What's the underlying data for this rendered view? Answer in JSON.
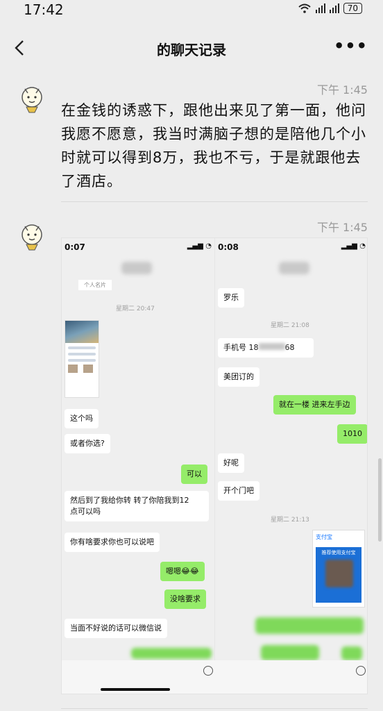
{
  "status": {
    "time": "17:42",
    "battery": "70"
  },
  "nav": {
    "title": "的聊天记录",
    "more": "•••"
  },
  "messages": [
    {
      "time": "下午 1:45",
      "text": "在金钱的诱惑下，跟他出来见了第一面，他问我愿不愿意，我当时满脑子想的是陪他几个小时就可以得到8万，我也不亏，于是就跟他去了酒店。"
    },
    {
      "time": "下午 1:45"
    }
  ],
  "screenshot": {
    "left": {
      "clock": "0:07",
      "card_caption": "个人名片",
      "timestamp": "星期二 20:47",
      "bubbles": [
        {
          "text": "这个吗",
          "side": "in"
        },
        {
          "text": "或者你选?",
          "side": "in"
        },
        {
          "text": "可以",
          "side": "out"
        },
        {
          "text": "然后到了我给你转 转了你陪我到12\n点可以吗",
          "side": "in"
        },
        {
          "text": "你有啥要求你也可以说吧",
          "side": "in"
        },
        {
          "text": "嗯嗯😂😂",
          "side": "out"
        },
        {
          "text": "没啥要求",
          "side": "out"
        },
        {
          "text": "当面不好说的话可以微信说",
          "side": "in"
        }
      ]
    },
    "right": {
      "clock": "0:08",
      "timestamp1": "星期二 21:08",
      "timestamp2": "星期二 21:13",
      "bubbles": [
        {
          "text": "罗乐",
          "side": "in"
        },
        {
          "text": "手机号 18",
          "side": "in",
          "suffix": "68"
        },
        {
          "text": "美团订的",
          "side": "in"
        },
        {
          "text": "就在一楼 进来左手边",
          "side": "out"
        },
        {
          "text": "1010",
          "side": "out"
        },
        {
          "text": "好呢",
          "side": "in"
        },
        {
          "text": "开个门吧",
          "side": "in"
        }
      ],
      "alipay": {
        "brand": "支付宝",
        "title": "推荐使用支付宝"
      }
    }
  }
}
